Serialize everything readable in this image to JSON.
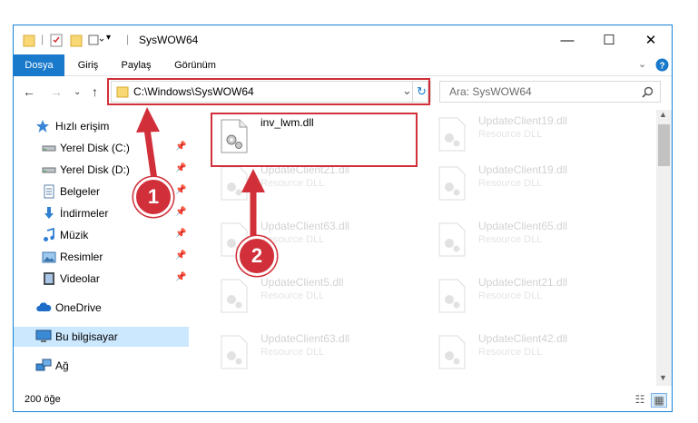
{
  "window": {
    "title": "SysWOW64",
    "minimize": "—",
    "maximize": "☐",
    "close": "✕"
  },
  "ribbon": {
    "tabs": [
      "Dosya",
      "Giriş",
      "Paylaş",
      "Görünüm"
    ],
    "expand_icon": "chevron-down-icon",
    "help_icon": "help-icon",
    "accent": "#1979ca"
  },
  "nav": {
    "back_icon": "arrow-left-icon",
    "forward_icon": "arrow-right-icon",
    "up_icon": "arrow-up-icon",
    "address": "C:\\Windows\\SysWOW64",
    "search_placeholder": "Ara: SysWOW64"
  },
  "sidebar": {
    "items": [
      {
        "label": "Hızlı erişim",
        "icon": "star-icon"
      },
      {
        "label": "Yerel Disk (C:)",
        "icon": "drive-icon",
        "pinned": true
      },
      {
        "label": "Yerel Disk (D:)",
        "icon": "drive-icon",
        "pinned": true
      },
      {
        "label": "Belgeler",
        "icon": "documents-icon",
        "pinned": true
      },
      {
        "label": "İndirmeler",
        "icon": "download-icon",
        "pinned": true
      },
      {
        "label": "Müzik",
        "icon": "music-icon",
        "pinned": true
      },
      {
        "label": "Resimler",
        "icon": "pictures-icon",
        "pinned": true
      },
      {
        "label": "Videolar",
        "icon": "videos-icon",
        "pinned": true
      },
      {
        "label": "OneDrive",
        "icon": "onedrive-icon"
      },
      {
        "label": "Bu bilgisayar",
        "icon": "computer-icon",
        "selected": true
      },
      {
        "label": "Ağ",
        "icon": "network-icon"
      }
    ]
  },
  "files": {
    "highlighted": {
      "name": "inv_lwm.dll"
    },
    "left_column": [
      {
        "name": "UpdateClient21.dll",
        "type": "Resource DLL"
      },
      {
        "name": "UpdateClient63.dll",
        "type": "Resource DLL"
      },
      {
        "name": "UpdateClient5.dll",
        "type": "Resource DLL"
      },
      {
        "name": "UpdateClient63.dll",
        "type": "Resource DLL"
      }
    ],
    "right_column": [
      {
        "name": "UpdateClient19.dll",
        "type": "Resource DLL"
      },
      {
        "name": "UpdateClient19.dll",
        "type": "Resource DLL"
      },
      {
        "name": "UpdateClient65.dll",
        "type": "Resource DLL"
      },
      {
        "name": "UpdateClient21.dll",
        "type": "Resource DLL"
      },
      {
        "name": "UpdateClient42.dll",
        "type": "Resource DLL"
      }
    ]
  },
  "status": {
    "count": "200 öğe"
  },
  "annotations": {
    "step1": "1",
    "step2": "2",
    "color": "#d1303a"
  }
}
